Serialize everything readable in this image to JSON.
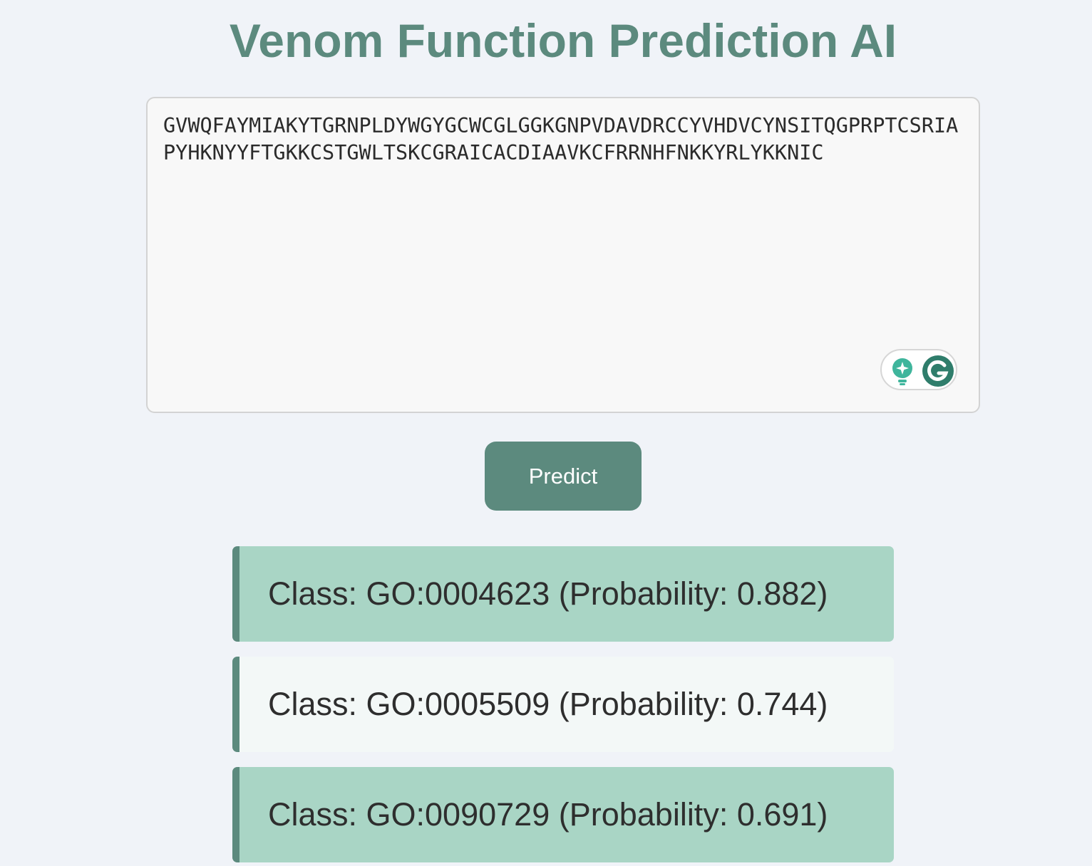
{
  "header": {
    "title": "Venom Function Prediction AI"
  },
  "input": {
    "sequence": "GVWQFAYMIAKYTGRNPLDYWGYGCWCGLGGKGNPVDAVDRCCYVHDVCYNSITQGPRPTCSRIAPYHKNYYFTGKKCSTGWLTSKCGRAICACDIAAVKCFRRNHFNKKYRLYKKNIC"
  },
  "widget": {
    "icons": [
      "lightbulb-sparkle-icon",
      "grammarly-g-icon"
    ]
  },
  "actions": {
    "predict_label": "Predict"
  },
  "colors": {
    "accent": "#5c8a7e",
    "background": "#f0f3f8",
    "result_highlight": "#a9d5c5",
    "result_plain": "#f3f8f7"
  },
  "results": [
    {
      "text": "Class: GO:0004623 (Probability: 0.882)"
    },
    {
      "text": "Class: GO:0005509 (Probability: 0.744)"
    },
    {
      "text": "Class: GO:0090729 (Probability: 0.691)"
    }
  ]
}
